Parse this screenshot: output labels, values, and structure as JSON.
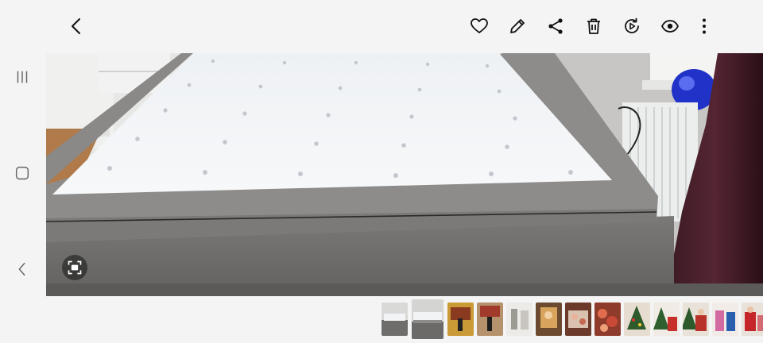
{
  "toolbar": {
    "back": "back-icon",
    "actions": [
      "heart-icon",
      "edit-icon",
      "share-icon",
      "delete-icon",
      "play-video-icon",
      "eye-icon",
      "more-icon"
    ]
  },
  "nav": {
    "buttons": [
      "recents-icon",
      "home-icon",
      "back-nav-icon"
    ]
  },
  "viewer": {
    "lens_button": "image-search-icon"
  },
  "filmstrip": {
    "thumb_count": 13,
    "current_index": 1
  },
  "colors": {
    "background": "#f4f4f4",
    "icon": "#111111"
  }
}
